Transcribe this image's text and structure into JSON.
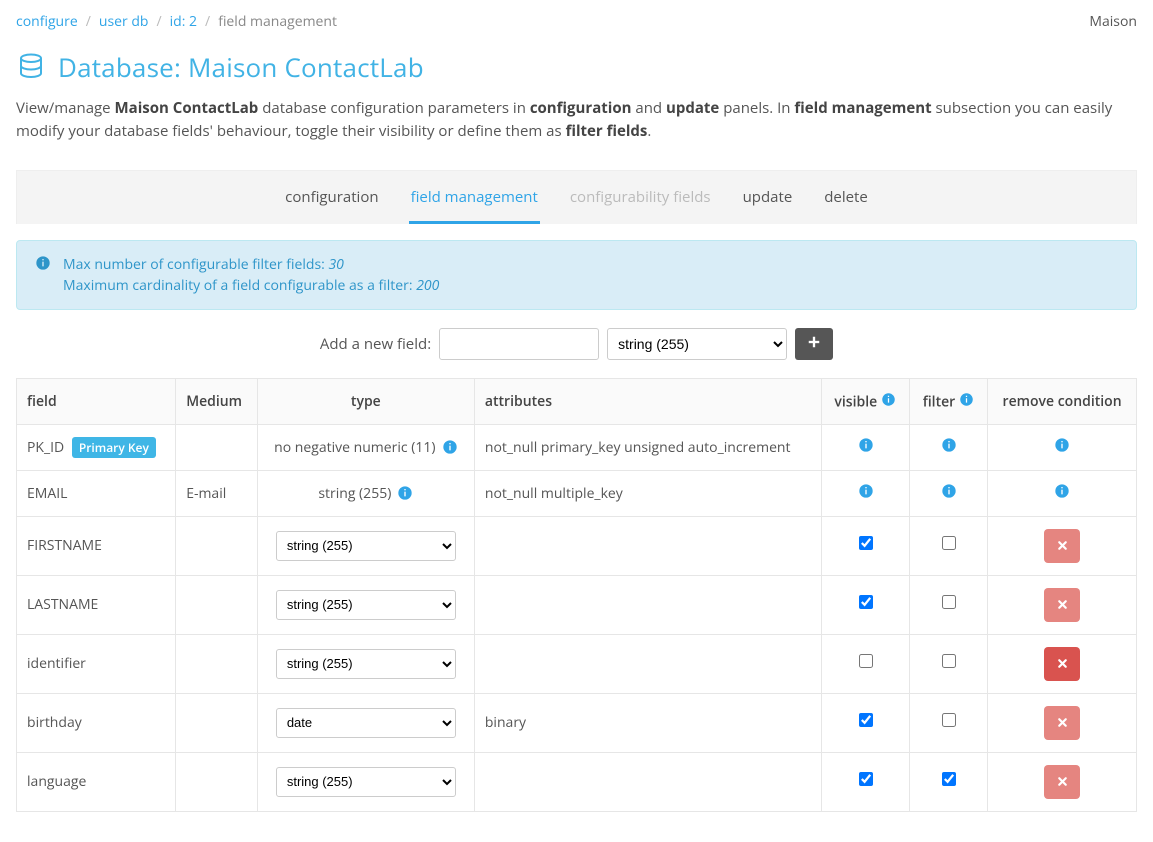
{
  "breadcrumb": {
    "items": [
      {
        "label": "configure",
        "link": true
      },
      {
        "label": "user db",
        "link": true
      },
      {
        "label": "id: 2",
        "link": true
      },
      {
        "label": "field management",
        "link": false
      }
    ],
    "right_label": "Maison"
  },
  "page_title": "Database: Maison ContactLab",
  "intro": {
    "a": "View/manage ",
    "b1": "Maison ContactLab",
    "c": " database configuration parameters in ",
    "b2": "configuration",
    "d": " and ",
    "b3": "update",
    "e": " panels. In ",
    "b4": "field management",
    "f": " subsection you can easily modify your database fields' behaviour, toggle their visibility or define them as ",
    "b5": "filter fields",
    "g": "."
  },
  "tabs": {
    "configuration": "configuration",
    "field_management": "field management",
    "configurability": "configurability fields",
    "update": "update",
    "delete": "delete"
  },
  "alert": {
    "line1_prefix": "Max number of configurable filter fields: ",
    "line1_value": "30",
    "line2_prefix": "Maximum cardinality of a field configurable as a filter: ",
    "line2_value": "200"
  },
  "add_field": {
    "label": "Add a new field:",
    "name_value": "",
    "type_value": "string (255)"
  },
  "type_options": [
    "string (255)",
    "no negative numeric (11)",
    "date"
  ],
  "table": {
    "headers": {
      "field": "field",
      "medium": "Medium",
      "type": "type",
      "attributes": "attributes",
      "visible": "visible",
      "filter": "filter",
      "remove": "remove condition"
    },
    "rows": [
      {
        "field": "PK_ID",
        "pk": true,
        "pk_label": "Primary Key",
        "medium": "",
        "type": "no negative numeric (11)",
        "type_editable": false,
        "attributes": "not_null primary_key unsigned auto_increment",
        "visible": "info",
        "filter": "info",
        "remove": "info"
      },
      {
        "field": "EMAIL",
        "pk": false,
        "medium": "E-mail",
        "type": "string (255)",
        "type_editable": false,
        "attributes": "not_null multiple_key",
        "visible": "info",
        "filter": "info",
        "remove": "info"
      },
      {
        "field": "FIRSTNAME",
        "pk": false,
        "medium": "",
        "type": "string (255)",
        "type_editable": true,
        "attributes": "",
        "visible": true,
        "filter": false,
        "remove": "light"
      },
      {
        "field": "LASTNAME",
        "pk": false,
        "medium": "",
        "type": "string (255)",
        "type_editable": true,
        "attributes": "",
        "visible": true,
        "filter": false,
        "remove": "light"
      },
      {
        "field": "identifier",
        "pk": false,
        "medium": "",
        "type": "string (255)",
        "type_editable": true,
        "attributes": "",
        "visible": false,
        "filter": false,
        "remove": "danger"
      },
      {
        "field": "birthday",
        "pk": false,
        "medium": "",
        "type": "date",
        "type_editable": true,
        "attributes": "binary",
        "visible": true,
        "filter": false,
        "remove": "light"
      },
      {
        "field": "language",
        "pk": false,
        "medium": "",
        "type": "string (255)",
        "type_editable": true,
        "attributes": "",
        "visible": true,
        "filter": true,
        "remove": "light"
      }
    ]
  }
}
